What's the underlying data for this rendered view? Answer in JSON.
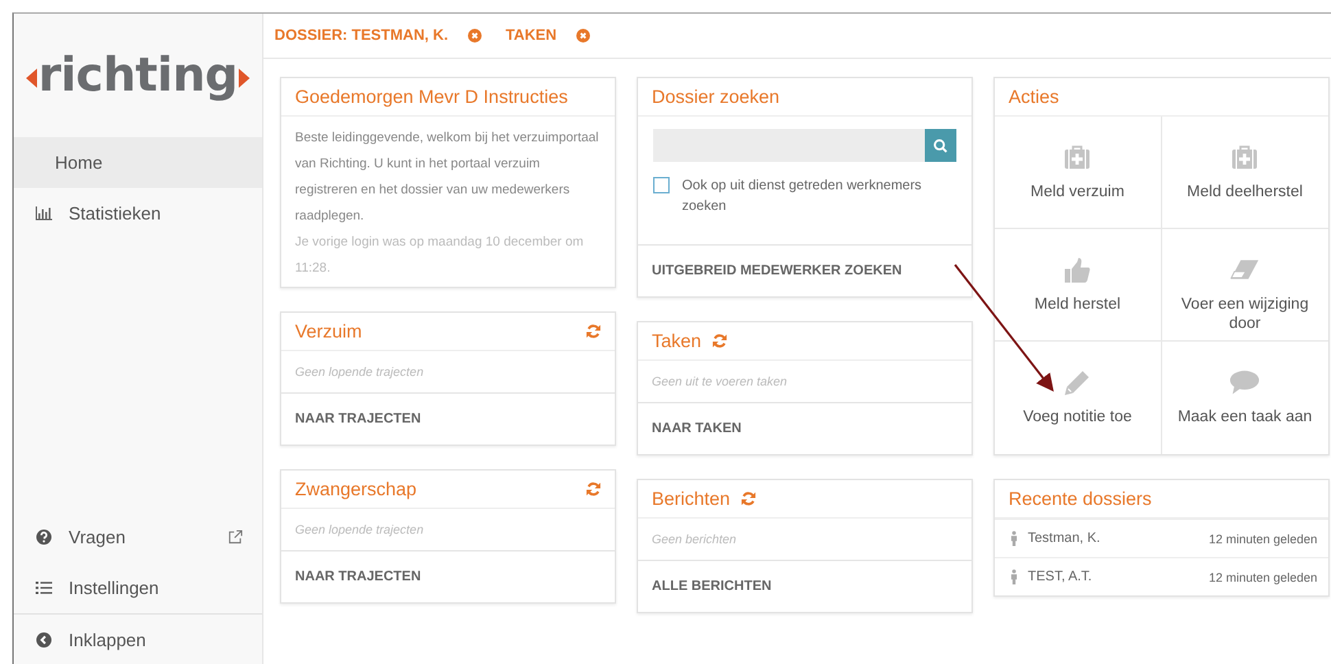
{
  "sidebar": {
    "logo": "richting",
    "items": [
      {
        "label": "Home",
        "selected": true,
        "kind": "plain"
      },
      {
        "label": "Statistieken",
        "selected": false,
        "kind": "chart"
      }
    ],
    "bottom_items": [
      {
        "label": "Vragen",
        "kind": "help",
        "external": true
      },
      {
        "label": "Instellingen",
        "kind": "list",
        "external": false
      },
      {
        "label": "Inklappen",
        "kind": "collapse",
        "external": false
      }
    ]
  },
  "breadcrumbs": [
    {
      "label": "DOSSIER: TESTMAN, K."
    },
    {
      "label": "TAKEN"
    }
  ],
  "columns": [
    [
      {
        "kind": "info",
        "title": "Goedemorgen Mevr D Instructies",
        "text": "Beste leidinggevende, welkom bij het verzuimportaal van Richting. U kunt in het portaal verzuim registreren en het dossier van uw medewerkers raadplegen.",
        "note": "Je vorige login was op maandag 10 december om 11:28."
      },
      {
        "kind": "tracker",
        "title": "Verzuim",
        "refresh": true,
        "empty": "Geen lopende trajecten",
        "link": "NAAR TRAJECTEN"
      },
      {
        "kind": "tracker",
        "title": "Zwangerschap",
        "refresh": true,
        "empty": "Geen lopende trajecten",
        "link": "NAAR TRAJECTEN"
      }
    ],
    [
      {
        "kind": "search",
        "title": "Dossier zoeken",
        "checkbox": {
          "label": "Ook op uit dienst getreden werknemers zoeken",
          "checked": false
        },
        "link": "UITGEBREID MEDEWERKER ZOEKEN"
      },
      {
        "kind": "feed",
        "title": "Taken",
        "refresh": true,
        "empty": "Geen uit te voeren taken",
        "link": "NAAR TAKEN"
      },
      {
        "kind": "feed",
        "title": "Berichten",
        "refresh": true,
        "empty": "Geen berichten",
        "link": "ALLE BERICHTEN"
      }
    ],
    [
      {
        "kind": "actions",
        "title": "Acties",
        "actions": [
          {
            "label": "Meld verzuim",
            "kind": "kit"
          },
          {
            "label": "Meld deelherstel",
            "kind": "kit"
          },
          {
            "label": "Meld herstel",
            "kind": "thumb"
          },
          {
            "label": "Voer een wijziging door",
            "kind": "eraser"
          },
          {
            "label": "Voeg notitie toe",
            "kind": "pencil"
          },
          {
            "label": "Maak een taak aan",
            "kind": "bubble"
          }
        ]
      },
      {
        "kind": "recent",
        "title": "Recente dossiers",
        "rows": [
          {
            "name": "Testman, K.",
            "time": "12 minuten geleden"
          },
          {
            "name": "TEST, A.T.",
            "time": "12 minuten geleden"
          }
        ]
      }
    ]
  ]
}
